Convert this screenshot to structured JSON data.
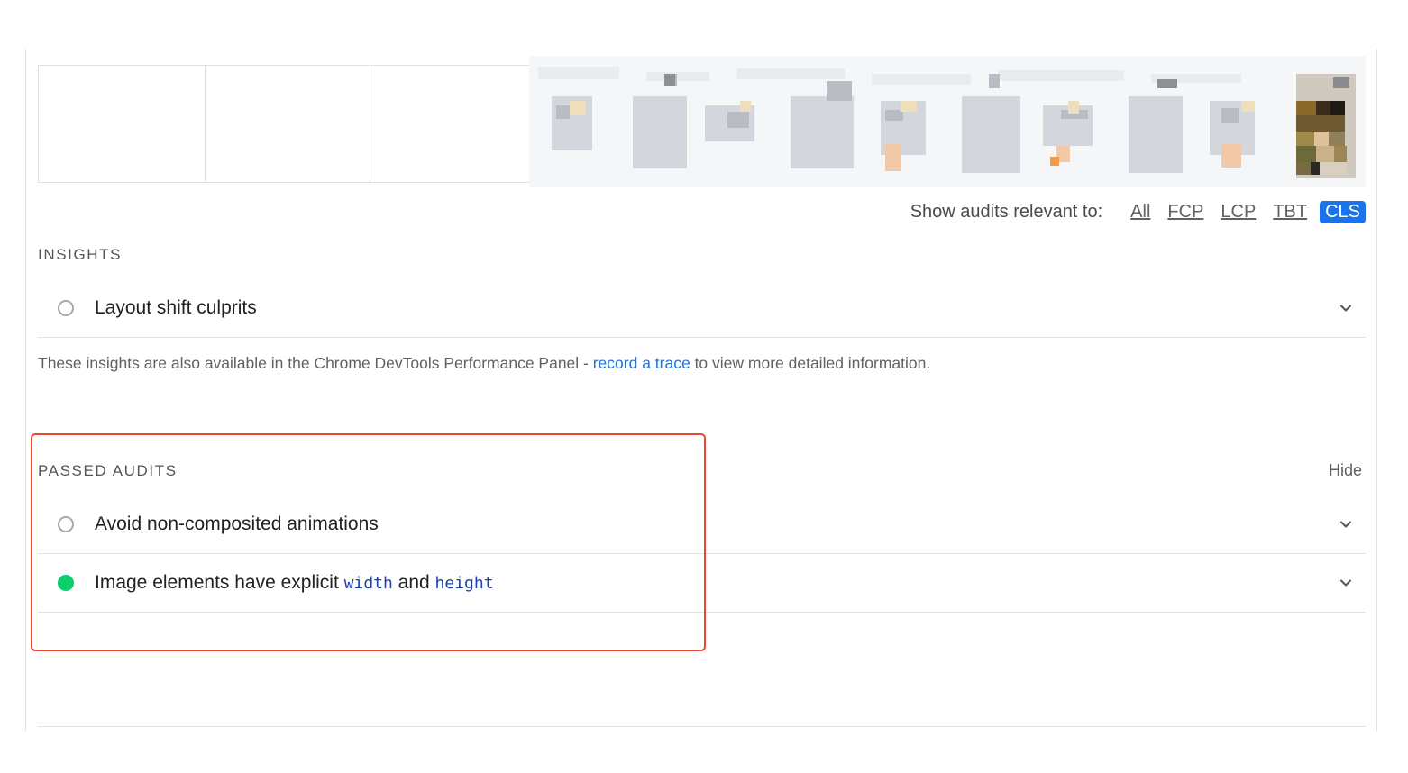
{
  "filter": {
    "label": "Show audits relevant to:",
    "options": [
      "All",
      "FCP",
      "LCP",
      "TBT",
      "CLS"
    ],
    "active": "CLS"
  },
  "insights": {
    "heading": "INSIGHTS",
    "items": [
      {
        "title": "Layout shift culprits",
        "status": "neutral"
      }
    ],
    "note": {
      "before": "These insights are also available in the Chrome DevTools Performance Panel - ",
      "link": "record a trace",
      "after": " to view more detailed information."
    }
  },
  "passed_audits": {
    "heading": "PASSED AUDITS",
    "toggle": "Hide",
    "items": [
      {
        "title": "Avoid non-composited animations",
        "status": "neutral"
      },
      {
        "title_parts": [
          "Image elements have explicit ",
          "width",
          " and ",
          "height"
        ],
        "status": "pass"
      }
    ]
  },
  "colors": {
    "accent": "#1a73e8",
    "pass": "#0cce6b",
    "highlight": "#e8492f"
  }
}
